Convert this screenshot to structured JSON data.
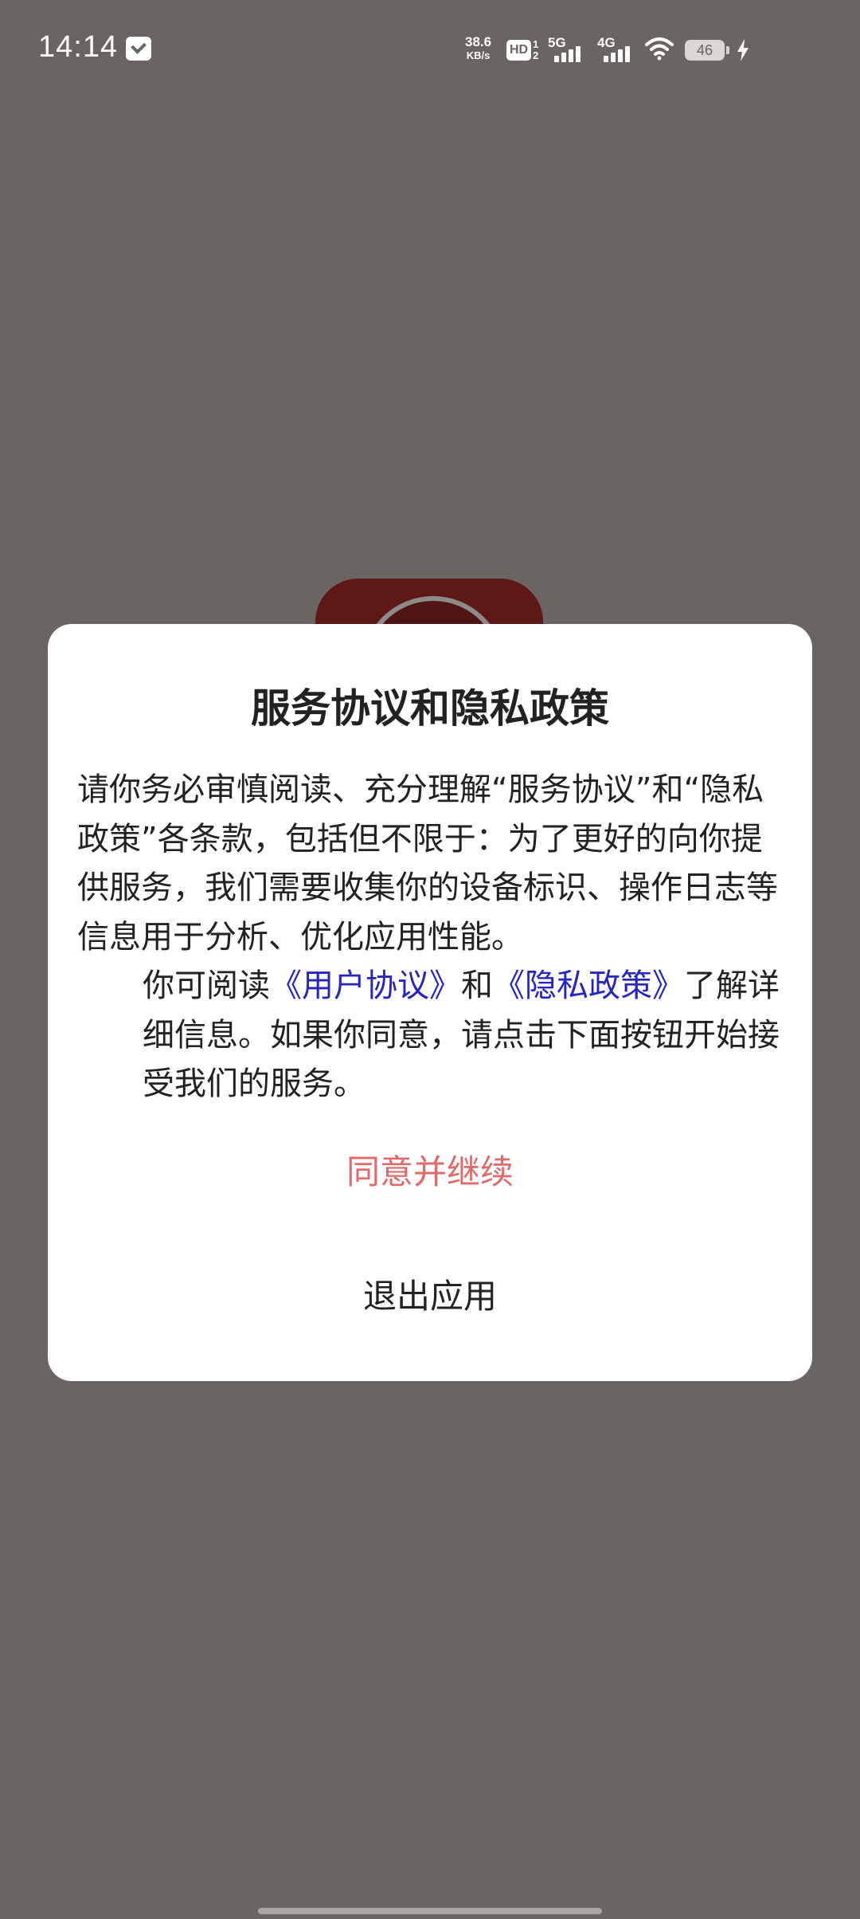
{
  "status_bar": {
    "time": "14:14",
    "net_speed_value": "38.6",
    "net_speed_unit": "KB/s",
    "hd_label": "HD",
    "hd_sim_1": "1",
    "hd_sim_2": "2",
    "signal_1_label": "5G",
    "signal_2_label": "4G",
    "battery_level": "46",
    "icons": [
      "mail-icon",
      "hd-icon",
      "signal-5g-icon",
      "signal-4g-icon",
      "wifi-icon",
      "battery-icon",
      "charging-icon"
    ]
  },
  "dialog": {
    "title": "服务协议和隐私政策",
    "paragraph_1": "请你务必审慎阅读、充分理解“服务协议”和“隐私政策”各条款，包括但不限于：为了更好的向你提供服务，我们需要收集你的设备标识、操作日志等信息用于分析、优化应用性能。",
    "paragraph_2_prefix": "你可阅读",
    "user_agreement_link": "《用户协议》",
    "paragraph_2_and": "和",
    "privacy_policy_link": "《隐私政策》",
    "paragraph_2_suffix": "了解详细信息。如果你同意，请点击下面按钮开始接受我们的服务。",
    "agree_button": "同意并继续",
    "exit_button": "退出应用"
  },
  "colors": {
    "overlay_background": "#6a6563",
    "dialog_background": "#ffffff",
    "agree_text": "#e06a6a",
    "link_text": "#2525c4",
    "body_text": "#222222"
  }
}
